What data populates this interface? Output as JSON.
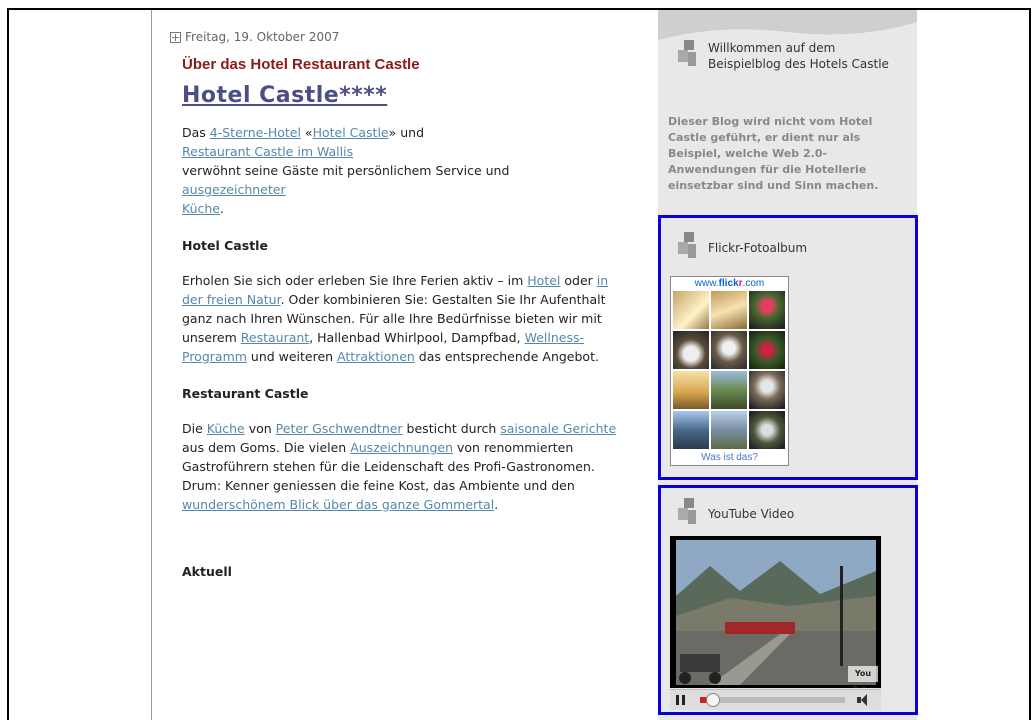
{
  "post": {
    "date": "Freitag, 19. Oktober 2007",
    "section_title": "Über das Hotel Restaurant Castle",
    "title": "Hotel Castle****",
    "p1": {
      "t1": "Das ",
      "l1": "4-Sterne-Hotel",
      "t2": " «",
      "l2": "Hotel Castle",
      "t3": "» und ",
      "l3": "Restaurant Castle im Wallis",
      "t4": " verwöhnt seine Gäste mit persönlichem Service und ",
      "l4": "ausgezeichneter Küche",
      "t5": "."
    },
    "h1": "Hotel Castle",
    "p2": {
      "t1": "Erholen Sie sich oder erleben Sie Ihre Ferien aktiv – im ",
      "l1": "Hotel",
      "t2": " oder ",
      "l2": "in der freien Natur",
      "t3": ". Oder kombinieren Sie: Gestalten Sie Ihr Aufenthalt ganz nach Ihren Wünschen. Für alle Ihre Bedürfnisse bieten wir mit unserem ",
      "l3": "Restaurant",
      "t4": ", Hallenbad Whirlpool, Dampfbad, ",
      "l4": "Wellness-Programm",
      "t5": " und weiteren ",
      "l5": "Attraktionen",
      "t6": " das entsprechende Angebot."
    },
    "h2": "Restaurant Castle",
    "p3": {
      "t1": "Die ",
      "l1": "Küche",
      "t2": " von ",
      "l2": "Peter Gschwendtner",
      "t3": " besticht durch ",
      "l3": "saisonale Gerichte",
      "t4": " aus dem Goms. Die vielen ",
      "l4": "Auszeichnungen",
      "t5": " von renommierten Gastroführern stehen für die Leidenschaft des Profi-Gastronomen. Drum: Kenner geniessen die feine Kost, das Ambiente und den ",
      "l5": "wunderschönem Blick über das ganze Gommertal",
      "t6": "."
    },
    "aktuell": "Aktuell"
  },
  "sidebar": {
    "welcome_title": "Willkommen auf dem Beispielblog des Hotels Castle",
    "welcome_text": "Dieser Blog wird nicht vom Hotel Castle geführt, er dient nur als Beispiel, welche Web 2.0-Anwendungen für die Hotellerie einsetzbar sind und Sinn machen.",
    "flickr_title": "Flickr-Fotoalbum",
    "flickr_head_pre": "www.",
    "flickr_head_brand": "flick",
    "flickr_head_r": "r",
    "flickr_head_post": ".com",
    "flickr_foot": "Was ist das?",
    "youtube_title": "YouTube Video",
    "youtube_logo": "You Tube"
  },
  "colors": {
    "section_title": "#8b1a1a",
    "post_title": "#4d4d86",
    "link": "#5588aa",
    "highlight_border": "#0a00d8",
    "sidebar_bg": "#e8e8e8"
  },
  "icons": [
    "collapse-box-icon",
    "blog-logo-icon",
    "play-pause-icon",
    "volume-icon"
  ]
}
